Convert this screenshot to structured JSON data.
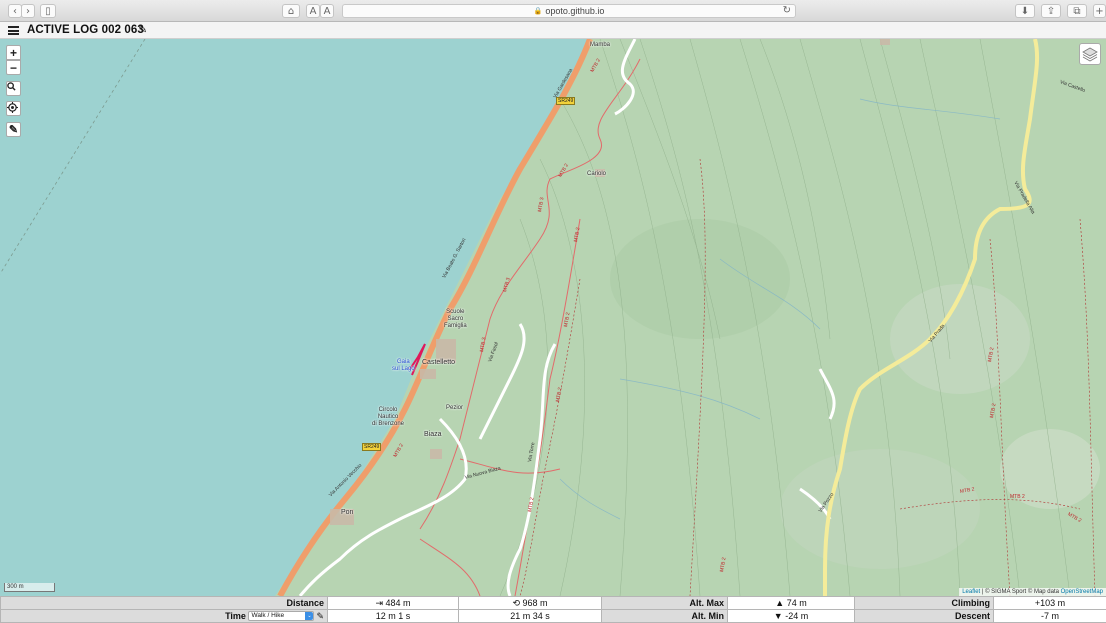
{
  "browser": {
    "url": "opoto.github.io",
    "lock_icon": "lock-icon",
    "reader_label_small": "A",
    "reader_label_large": "A"
  },
  "header": {
    "title": "ACTIVE LOG 002 063",
    "menu_icon": "hamburger-menu-icon",
    "edit_icon": "pencil-icon"
  },
  "map": {
    "controls": {
      "zoom_in": "+",
      "zoom_out": "−",
      "search_icon": "magnifier-icon",
      "locate_icon": "crosshair-icon",
      "draw_icon": "pencil-icon",
      "layers_icon": "layers-icon"
    },
    "scale": "300 m",
    "attribution": {
      "leaflet": "Leaflet",
      "sep1": " | © SIGMA Sport © Map data ",
      "osm": "OpenStreetMap"
    },
    "places": {
      "mamba": "Mamba",
      "cariolo": "Cariolo",
      "scuola": "Scuole\nSacro\nFamiglia",
      "castelletto": "Castelletto",
      "pezior": "Pezior",
      "circolo": "Circolo\nNautico\ndi Brenzone",
      "biaza": "Biaza",
      "pon": "Pon",
      "gaia": "Gaia\nsul Lago"
    },
    "road_labels": {
      "gardesana": "Via Gardesana",
      "bellini": "Via Beato G. Sartori",
      "sr249a": "SR249",
      "sr249b": "SR249",
      "via_fasol": "Via Fasol",
      "via_castello": "Via Castello",
      "via_nuova": "Via Nuova Biaza",
      "via_antonio": "Via Antonio Vecchio",
      "via_torre": "Via Torre",
      "via_prada": "Via Prada",
      "via_pozzo": "Via Pozzo",
      "via_pradella": "Via Pradella Alta"
    },
    "path_labels": [
      "MTB 2",
      "MTB 2",
      "MTB 3",
      "MTB 3",
      "MTB 3",
      "MTB 2",
      "MTB 2",
      "MTB 2",
      "MTB 2",
      "MTB 2",
      "MTB 2",
      "MTB 2",
      "MTB 2",
      "MTB 2",
      "MTB 2",
      "MTB 2"
    ]
  },
  "stats": {
    "distance_label": "Distance",
    "distance_total_icon": "arrow-to-end-icon",
    "distance_total": "484 m",
    "distance_reset_icon": "reset-icon",
    "distance_alt": "968 m",
    "alt_max_label": "Alt. Max",
    "alt_max_icon": "triangle-up-icon",
    "alt_max": "74 m",
    "climbing_label": "Climbing",
    "climbing": "+103 m",
    "time_label": "Time",
    "mode_selected": "Walk / Hike",
    "mode_edit_icon": "pencil-icon",
    "time_1": "12 m 1 s",
    "time_2": "21 m 34 s",
    "alt_min_label": "Alt. Min",
    "alt_min_icon": "triangle-down-icon",
    "alt_min": "-24 m",
    "descent_label": "Descent",
    "descent": "-7 m"
  }
}
